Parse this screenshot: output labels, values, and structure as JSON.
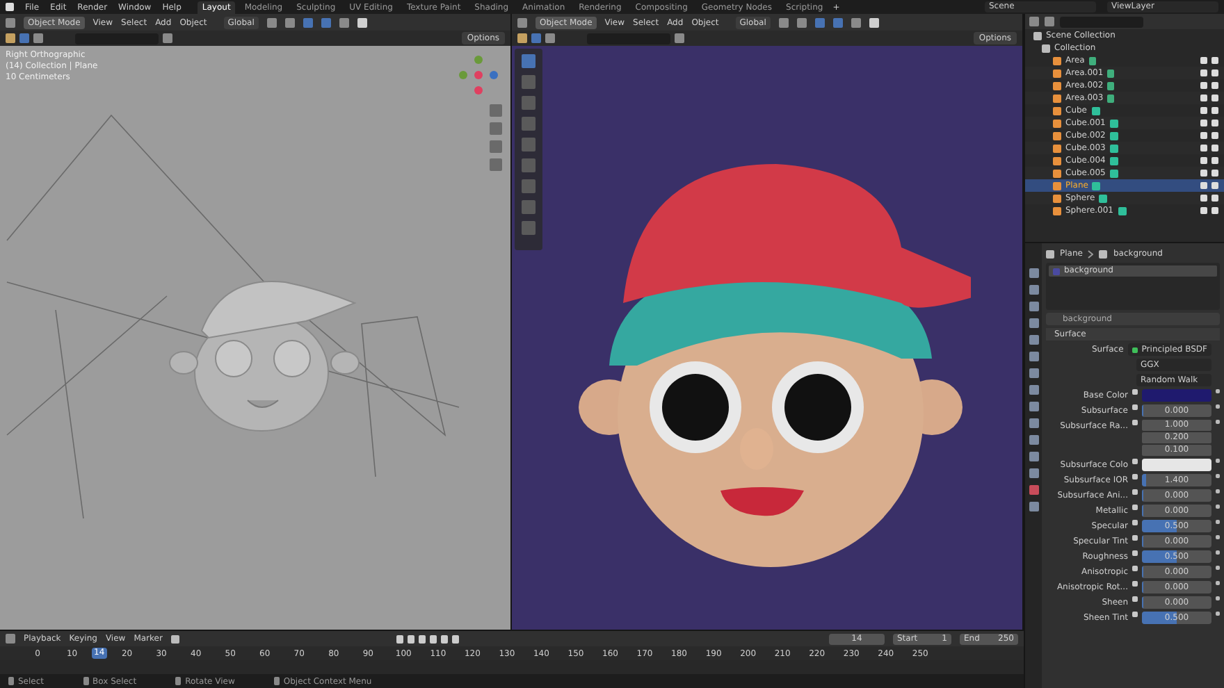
{
  "menu": [
    "File",
    "Edit",
    "Render",
    "Window",
    "Help"
  ],
  "workspaces": [
    {
      "label": "Layout",
      "selected": true
    },
    {
      "label": "Modeling",
      "selected": false
    },
    {
      "label": "Sculpting",
      "selected": false
    },
    {
      "label": "UV Editing",
      "selected": false
    },
    {
      "label": "Texture Paint",
      "selected": false
    },
    {
      "label": "Shading",
      "selected": false
    },
    {
      "label": "Animation",
      "selected": false
    },
    {
      "label": "Rendering",
      "selected": false
    },
    {
      "label": "Compositing",
      "selected": false
    },
    {
      "label": "Geometry Nodes",
      "selected": false
    },
    {
      "label": "Scripting",
      "selected": false
    }
  ],
  "add_workspace": "+",
  "scene": "Scene",
  "view_layer": "ViewLayer",
  "viewports": [
    {
      "kind": "ortho",
      "mode": "Object Mode",
      "menus": [
        "View",
        "Select",
        "Add",
        "Object"
      ],
      "orientation": "Global",
      "options": "Options",
      "overlay": [
        "Right Orthographic",
        "(14) Collection | Plane",
        "10 Centimeters"
      ]
    },
    {
      "kind": "render",
      "mode": "Object Mode",
      "menus": [
        "View",
        "Select",
        "Add",
        "Object"
      ],
      "orientation": "Global",
      "options": "Options"
    }
  ],
  "outliner": {
    "root": "Scene Collection",
    "collection": "Collection",
    "items": [
      {
        "name": "Area",
        "kind": "light",
        "selected": false
      },
      {
        "name": "Area.001",
        "kind": "light",
        "selected": false
      },
      {
        "name": "Area.002",
        "kind": "light",
        "selected": false
      },
      {
        "name": "Area.003",
        "kind": "light",
        "selected": false
      },
      {
        "name": "Cube",
        "kind": "mesh",
        "selected": false
      },
      {
        "name": "Cube.001",
        "kind": "mesh",
        "selected": false
      },
      {
        "name": "Cube.002",
        "kind": "mesh",
        "selected": false
      },
      {
        "name": "Cube.003",
        "kind": "mesh",
        "selected": false
      },
      {
        "name": "Cube.004",
        "kind": "mesh",
        "selected": false
      },
      {
        "name": "Cube.005",
        "kind": "mesh",
        "selected": false
      },
      {
        "name": "Plane",
        "kind": "mesh",
        "selected": true
      },
      {
        "name": "Sphere",
        "kind": "mesh",
        "selected": false
      },
      {
        "name": "Sphere.001",
        "kind": "mesh",
        "selected": false
      }
    ]
  },
  "properties": {
    "breadcrumb": [
      "Plane",
      "background"
    ],
    "slot": "background",
    "material": "background",
    "panel": "Surface",
    "surface_label": "Surface",
    "surface": "Principled BSDF",
    "dropdowns": [
      "GGX",
      "Random Walk"
    ],
    "rows": [
      {
        "label": "Base Color",
        "kind": "color",
        "color": "#1f1a6e"
      },
      {
        "label": "Subsurface",
        "kind": "slider",
        "value": "0.000",
        "level": 0
      },
      {
        "label": "Subsurface Ra...",
        "kind": "vector",
        "values": [
          "1.000",
          "0.200",
          "0.100"
        ]
      },
      {
        "label": "Subsurface Colo",
        "kind": "color",
        "color": "#e6e6e6"
      },
      {
        "label": "Subsurface IOR",
        "kind": "slider",
        "value": "1.400",
        "level": 0.06
      },
      {
        "label": "Subsurface Ani...",
        "kind": "slider",
        "value": "0.000",
        "level": 0
      },
      {
        "label": "Metallic",
        "kind": "slider",
        "value": "0.000",
        "level": 0
      },
      {
        "label": "Specular",
        "kind": "slider",
        "value": "0.500",
        "level": 0.5
      },
      {
        "label": "Specular Tint",
        "kind": "slider",
        "value": "0.000",
        "level": 0
      },
      {
        "label": "Roughness",
        "kind": "slider",
        "value": "0.500",
        "level": 0.5
      },
      {
        "label": "Anisotropic",
        "kind": "slider",
        "value": "0.000",
        "level": 0
      },
      {
        "label": "Anisotropic Rot...",
        "kind": "slider",
        "value": "0.000",
        "level": 0
      },
      {
        "label": "Sheen",
        "kind": "slider",
        "value": "0.000",
        "level": 0
      },
      {
        "label": "Sheen Tint",
        "kind": "slider",
        "value": "0.500",
        "level": 0.5
      }
    ]
  },
  "timeline": {
    "menus": [
      "Playback",
      "Keying",
      "View",
      "Marker"
    ],
    "frame": "14",
    "playhead_frame": "14",
    "start_label": "Start",
    "start": "1",
    "end_label": "End",
    "end": "250",
    "ticks": [
      "0",
      "10",
      "20",
      "30",
      "40",
      "50",
      "60",
      "70",
      "80",
      "90",
      "100",
      "110",
      "120",
      "130",
      "140",
      "150",
      "160",
      "170",
      "180",
      "190",
      "200",
      "210",
      "220",
      "230",
      "240",
      "250"
    ]
  },
  "status_bar": [
    "Select",
    "Box Select",
    "Rotate View",
    "Object Context Menu"
  ]
}
